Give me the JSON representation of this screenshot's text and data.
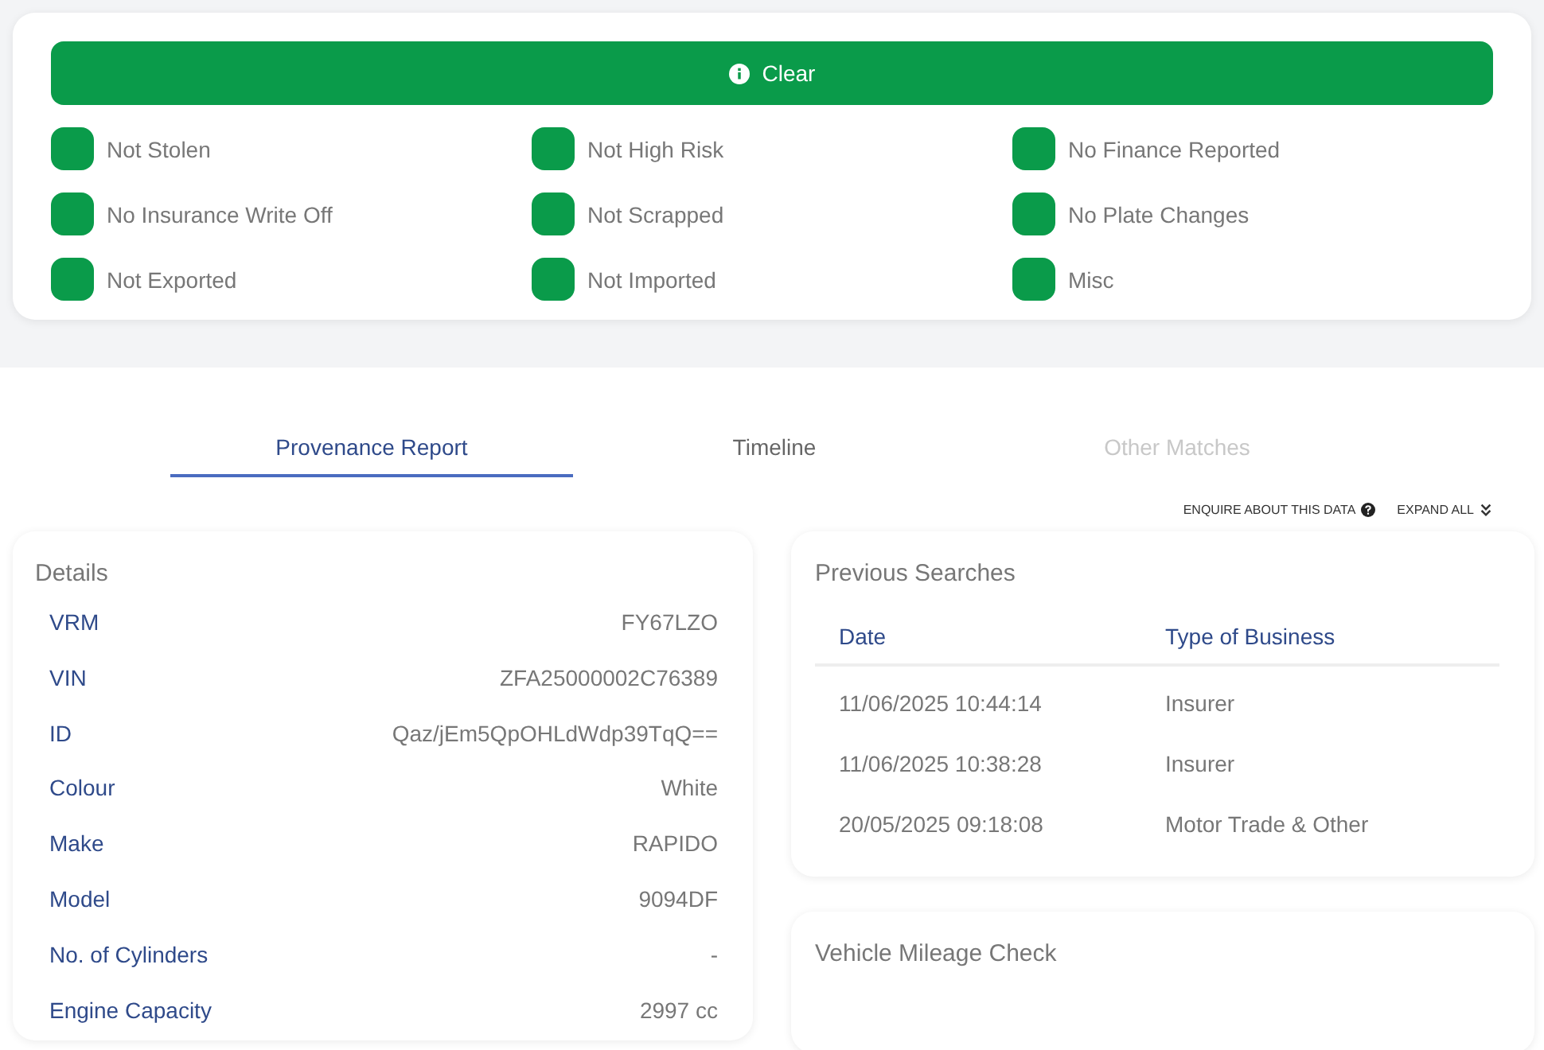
{
  "summary": {
    "banner": "Clear",
    "checks": [
      {
        "label": "Not Stolen",
        "passed": true
      },
      {
        "label": "Not High Risk",
        "passed": true
      },
      {
        "label": "No Finance Reported",
        "passed": true
      },
      {
        "label": "No Insurance Write Off",
        "passed": true
      },
      {
        "label": "Not Scrapped",
        "passed": true
      },
      {
        "label": "No Plate Changes",
        "passed": true
      },
      {
        "label": "Not Exported",
        "passed": true
      },
      {
        "label": "Not Imported",
        "passed": true
      },
      {
        "label": "Misc",
        "passed": true
      }
    ]
  },
  "tabs": [
    {
      "label": "Provenance Report",
      "selected": true,
      "disabled": false
    },
    {
      "label": "Timeline",
      "selected": false,
      "disabled": false
    },
    {
      "label": "Other Matches",
      "selected": false,
      "disabled": true
    }
  ],
  "actions": {
    "enquire": "ENQUIRE ABOUT THIS DATA",
    "expand": "EXPAND ALL"
  },
  "details": {
    "title": "Details",
    "rows": [
      {
        "label": "VRM",
        "value": "FY67LZO"
      },
      {
        "label": "VIN",
        "value": "ZFA25000002C76389"
      },
      {
        "label": "ID",
        "value": "Qaz/jEm5QpOHLdWdp39TqQ=="
      },
      {
        "label": "Colour",
        "value": "White"
      },
      {
        "label": "Make",
        "value": "RAPIDO"
      },
      {
        "label": "Model",
        "value": "9094DF"
      },
      {
        "label": "No. of Cylinders",
        "value": "-"
      },
      {
        "label": "Engine Capacity",
        "value": "2997 cc"
      }
    ]
  },
  "previous_searches": {
    "title": "Previous Searches",
    "columns": [
      "Date",
      "Type of Business"
    ],
    "rows": [
      [
        "11/06/2025 10:44:14",
        "Insurer"
      ],
      [
        "11/06/2025 10:38:28",
        "Insurer"
      ],
      [
        "20/05/2025 09:18:08",
        "Motor Trade & Other"
      ]
    ]
  },
  "mileage": {
    "title": "Vehicle Mileage Check"
  }
}
